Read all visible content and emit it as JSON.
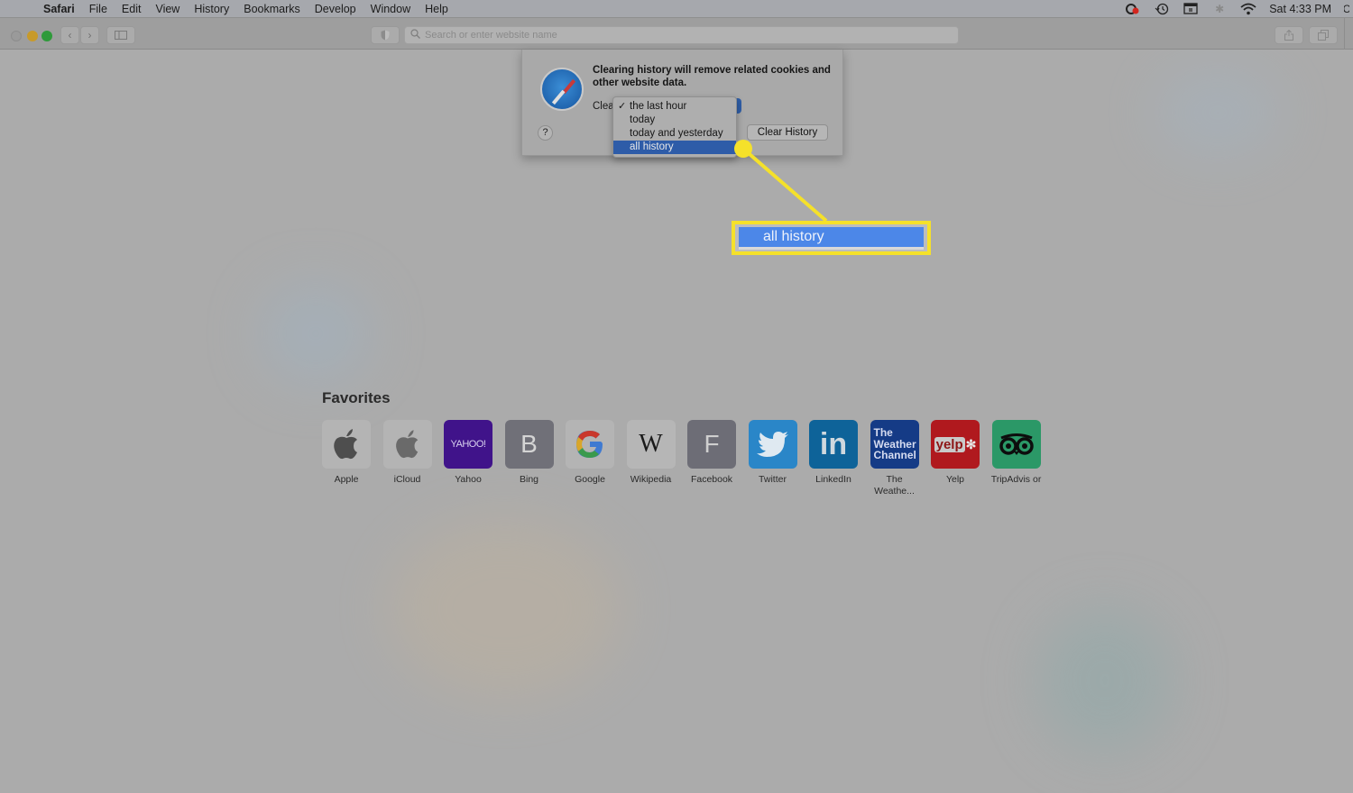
{
  "menubar": {
    "app_name": "Safari",
    "items": [
      "File",
      "Edit",
      "View",
      "History",
      "Bookmarks",
      "Develop",
      "Window",
      "Help"
    ],
    "status_icons": [
      "creative-cloud-icon",
      "time-machine-icon",
      "display-icon",
      "bluetooth-icon",
      "wifi-icon"
    ],
    "clock": "Sat 4:33 PM"
  },
  "toolbar": {
    "url_placeholder": "Search or enter website name"
  },
  "dialog": {
    "message": "Clearing history will remove related cookies and other website data.",
    "clear_label": "Clea",
    "help_label": "?",
    "clear_button": "Clear History",
    "dropdown": {
      "options": [
        {
          "label": "the last hour",
          "checked": true,
          "highlighted": false
        },
        {
          "label": "today",
          "checked": false,
          "highlighted": false
        },
        {
          "label": "today and yesterday",
          "checked": false,
          "highlighted": false
        },
        {
          "label": "all history",
          "checked": false,
          "highlighted": true
        }
      ],
      "check_glyph": "✓"
    }
  },
  "callout": {
    "label": "all history",
    "color": "#f5e12a"
  },
  "favorites": {
    "title": "Favorites",
    "items": [
      {
        "label": "Apple",
        "glyph": ""
      },
      {
        "label": "iCloud",
        "glyph": ""
      },
      {
        "label": "Yahoo",
        "glyph": "YAHOO!"
      },
      {
        "label": "Bing",
        "glyph": "B"
      },
      {
        "label": "Google",
        "glyph": "G"
      },
      {
        "label": "Wikipedia",
        "glyph": "W"
      },
      {
        "label": "Facebook",
        "glyph": "F"
      },
      {
        "label": "Twitter",
        "glyph": ""
      },
      {
        "label": "LinkedIn",
        "glyph": "in"
      },
      {
        "label": "The Weathe...",
        "glyph": "The Weather Channel"
      },
      {
        "label": "Yelp",
        "glyph": "yelp"
      },
      {
        "label": "TripAdvis or",
        "glyph": ""
      }
    ]
  }
}
